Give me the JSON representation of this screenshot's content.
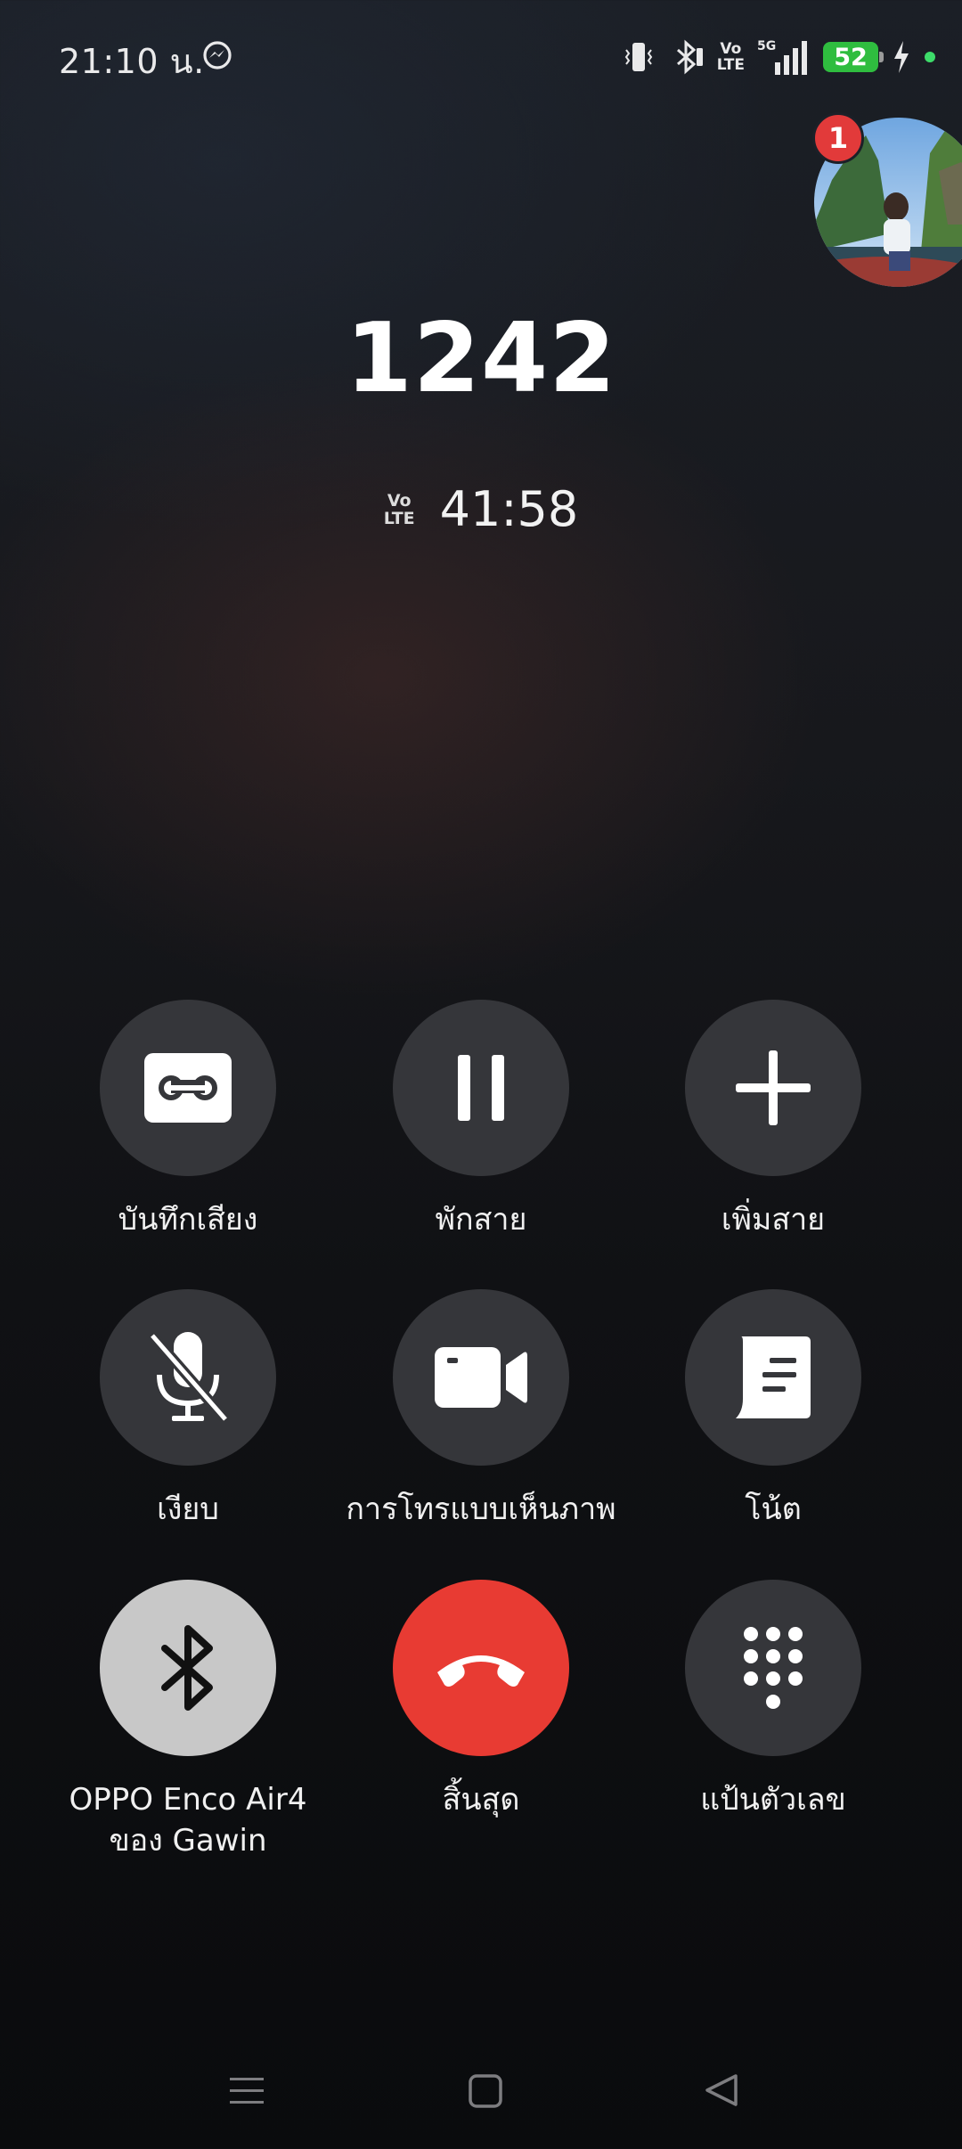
{
  "status": {
    "time": "21:10 น.",
    "network": "5G",
    "volte_line1": "Vo",
    "volte_line2": "LTE",
    "battery": "52",
    "icons": [
      "messenger-icon",
      "vibrate-icon",
      "bluetooth-icon",
      "volte-icon",
      "signal-5g-icon",
      "battery-icon",
      "charging-icon"
    ]
  },
  "avatar": {
    "badge": "1"
  },
  "call": {
    "number": "1242",
    "volte_line1": "Vo",
    "volte_line2": "LTE",
    "duration": "41:58"
  },
  "controls": {
    "record": "บันทึกเสียง",
    "hold": "พักสาย",
    "add_call": "เพิ่มสาย",
    "mute": "เงียบ",
    "video_call": "การโทรแบบเห็นภาพ",
    "note": "โน้ต",
    "bluetooth_line1": "OPPO Enco Air4",
    "bluetooth_line2": "ของ Gawin",
    "end_call": "สิ้นสุด",
    "keypad": "แป้นตัวเลข"
  },
  "colors": {
    "end_call": "#e83b33",
    "button": "#35363a",
    "active_button": "#c8c8c8",
    "badge": "#e23a3a",
    "battery": "#2fbd3f"
  }
}
